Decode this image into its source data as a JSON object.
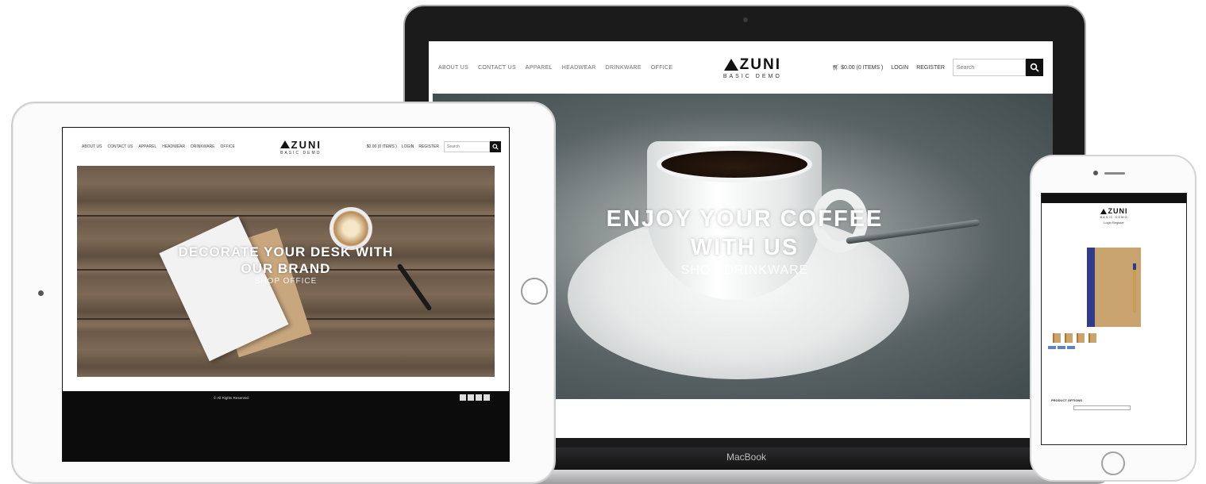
{
  "laptop": {
    "brand": "MacBook",
    "nav": {
      "links": [
        "ABOUT US",
        "CONTACT US",
        "APPAREL",
        "HEADWEAR",
        "DRINKWARE",
        "OFFICE"
      ],
      "logo_main": "ZUNI",
      "logo_sub": "BASIC DEMO",
      "cart": "$0.00 (0 ITEMS )",
      "login": "LOGIN",
      "register": "REGISTER",
      "search_placeholder": "Search"
    },
    "hero": {
      "heading_line1": "ENJOY YOUR COFFEE",
      "heading_line2": "WITH US",
      "cta": "SHOP DRINKWARE"
    }
  },
  "tablet": {
    "nav": {
      "links": [
        "ABOUT US",
        "CONTACT US",
        "APPAREL",
        "HEADWEAR",
        "DRINKWARE",
        "OFFICE"
      ],
      "logo_main": "ZUNI",
      "logo_sub": "BASIC DEMO",
      "cart": "$0.00 (0 ITEMS )",
      "login": "LOGIN",
      "register": "REGISTER",
      "search_placeholder": "Search"
    },
    "hero": {
      "heading_line1": "DECORATE YOUR DESK WITH",
      "heading_line2": "OUR BRAND",
      "cta": "SHOP OFFICE"
    },
    "footer": {
      "copyright": "© All Rights Reserved"
    }
  },
  "phone": {
    "logo_main": "ZUNI",
    "logo_sub": "BASIC DEMO",
    "auth": "Login  Register",
    "product_options_label": "PRODUCT OPTIONS"
  },
  "colors": {
    "brand_dark": "#111111",
    "footer_bg": "#0c0c0c",
    "price_gold": "#b8860b",
    "notebook_blue": "#2e3a8c"
  }
}
